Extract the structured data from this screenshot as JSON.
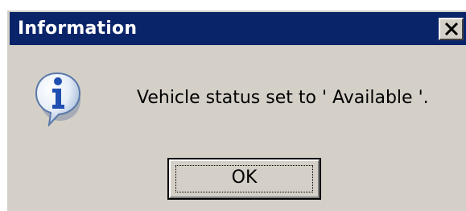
{
  "dialog": {
    "title": "Information",
    "message": "Vehicle status set to ' Available '.",
    "ok_label": "OK",
    "icon": "info-icon",
    "close_icon": "close-icon"
  },
  "colors": {
    "titlebar": "#0a246a",
    "title_text": "#ffffff",
    "dialog_bg": "#d4d0c8"
  }
}
